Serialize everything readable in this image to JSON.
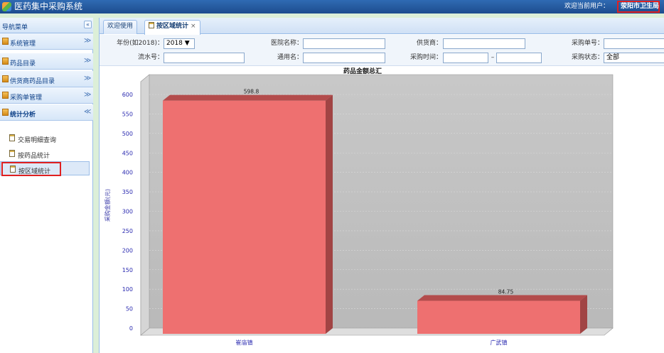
{
  "app": {
    "title": "医药集中采购系统",
    "welcome": "欢迎当前用户：",
    "user": "荥阳市卫生局"
  },
  "sidebar": {
    "title": "导航菜单",
    "collapse": "«",
    "sections": [
      {
        "label": "系统管理",
        "chevron": "≫"
      },
      {
        "label": "药品目录",
        "chevron": "≫"
      },
      {
        "label": "供货商药品目录",
        "chevron": "≫"
      },
      {
        "label": "采购单管理",
        "chevron": "≫"
      },
      {
        "label": "统计分析",
        "chevron": "≪"
      }
    ],
    "items": [
      {
        "label": "交易明细查询"
      },
      {
        "label": "按药品统计"
      },
      {
        "label": "按区域统计"
      }
    ]
  },
  "tabs": [
    {
      "label": "欢迎使用"
    },
    {
      "label": "按区域统计",
      "close": "×"
    }
  ],
  "filters": {
    "year_label": "年份(如2018)：",
    "year_value": "2018 ▼",
    "hospital_label": "医院名称：",
    "supplier_label": "供货商：",
    "order_no_label": "采购单号：",
    "serial_label": "流水号：",
    "common_name_label": "通用名：",
    "time_label": "采购时间：",
    "time_sep": "–",
    "status_label": "采购状态：",
    "status_value": "全部"
  },
  "chart_data": {
    "type": "bar",
    "title": "药品金额总汇",
    "ylabel": "采购金额(元)",
    "xlabel": "",
    "categories": [
      "崔庙镇",
      "广武镇"
    ],
    "values": [
      598.8,
      84.75
    ],
    "value_labels": [
      "598.8",
      "84.75"
    ],
    "yticks": [
      0,
      50,
      100,
      150,
      200,
      250,
      300,
      350,
      400,
      450,
      500,
      550,
      600
    ],
    "ylim": [
      0,
      600
    ],
    "bar_color": "#ee7070",
    "grid": true
  }
}
